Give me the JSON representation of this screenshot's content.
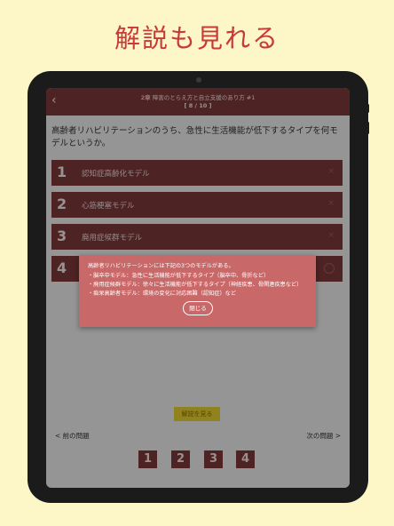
{
  "promo": {
    "headline": "解説も見れる"
  },
  "header": {
    "title_number": "2章",
    "title_text": "障害のとらえ方と自立支援のあり方 #1",
    "count": "[ 8 / 10 ]",
    "back_icon": "chevron-left-icon"
  },
  "question": {
    "text": "高齢者リハビリテーションのうち、急性に生活機能が低下するタイプを何モデルというか。"
  },
  "options": [
    {
      "number": "1",
      "label": "認知症高齢化モデル",
      "mark": "×"
    },
    {
      "number": "2",
      "label": "心筋梗塞モデル",
      "mark": "×"
    },
    {
      "number": "3",
      "label": "廃用症候群モデル",
      "mark": "×"
    },
    {
      "number": "4",
      "label": "",
      "mark": "circle-icon"
    }
  ],
  "popup": {
    "lines": [
      "高齢者リハビリテーションには下記の3つのモデルがある。",
      "・脳卒中モデル：急性に生活機能が低下するタイプ（脳卒中、骨折など）",
      "・廃用症候群モデル：徐々に生活機能が低下するタイプ（神経疾患、骨関連疾患など）",
      "・痴呆高齢者モデル：環境の変化に対応困難（認知症）など"
    ],
    "close_label": "閉じる"
  },
  "footer": {
    "explain_label": "解説を見る",
    "prev_label": "< 前の問題",
    "next_label": "次の問題 >",
    "number_buttons": [
      "1",
      "2",
      "3",
      "4"
    ]
  },
  "colors": {
    "background": "#fdf6c7",
    "headline": "#c83a3a",
    "option": "#7b3838",
    "popup": "#c96868",
    "explain_button": "#e1cc2d"
  }
}
